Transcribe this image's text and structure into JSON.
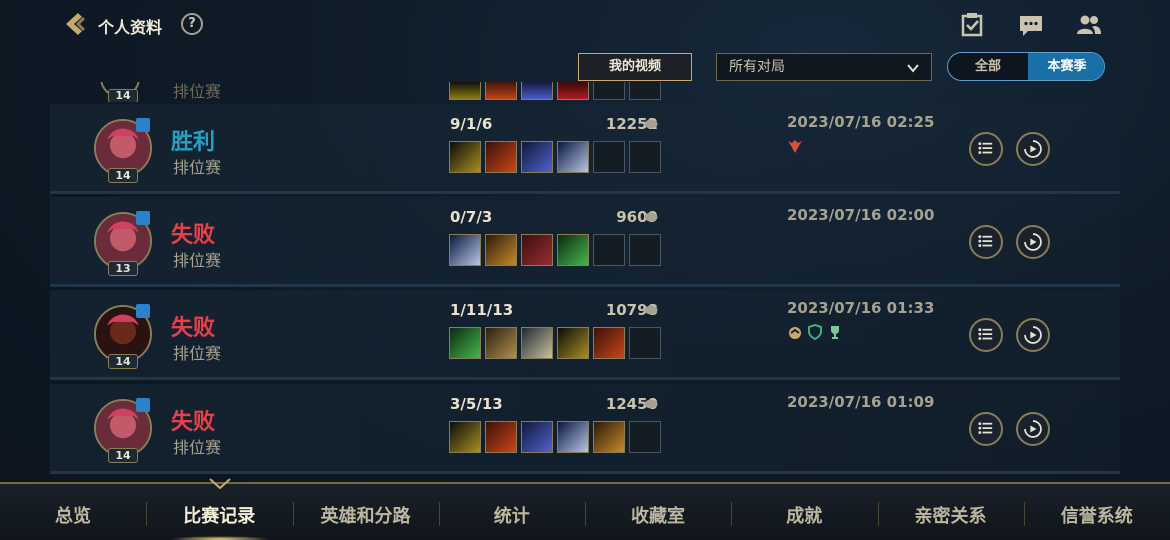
{
  "header": {
    "title": "个人资料",
    "help": "?",
    "icons": [
      "back-chevron-icon",
      "help-icon",
      "checklist-icon",
      "chat-icon",
      "friends-icon"
    ]
  },
  "filters": {
    "video_button": "我的视频",
    "match_filter": "所有对局",
    "season_toggle": {
      "all": "全部",
      "season": "本赛季",
      "selected": "本赛季"
    }
  },
  "partial_row": {
    "level": "14",
    "mode": "排位赛"
  },
  "matches": [
    {
      "result": "胜利",
      "outcome": "win",
      "mode": "排位赛",
      "level": "14",
      "kda": "9/1/6",
      "gold": "12252",
      "date": "2023/07/16 02:25",
      "items_filled": 4,
      "badges": [
        "mvp-wings-icon"
      ]
    },
    {
      "result": "失败",
      "outcome": "loss",
      "mode": "排位赛",
      "level": "13",
      "kda": "0/7/3",
      "gold": "9609",
      "date": "2023/07/16 02:00",
      "items_filled": 4,
      "badges": []
    },
    {
      "result": "失败",
      "outcome": "loss",
      "mode": "排位赛",
      "level": "14",
      "kda": "1/11/13",
      "gold": "10798",
      "date": "2023/07/16 01:33",
      "items_filled": 5,
      "badges": [
        "medal-icon",
        "shield-icon",
        "trophy-icon"
      ]
    },
    {
      "result": "失败",
      "outcome": "loss",
      "mode": "排位赛",
      "level": "14",
      "kda": "3/5/13",
      "gold": "12450",
      "date": "2023/07/16 01:09",
      "items_filled": 5,
      "badges": []
    }
  ],
  "tabs": [
    {
      "label": "总览"
    },
    {
      "label": "比赛记录",
      "active": true
    },
    {
      "label": "英雄和分路"
    },
    {
      "label": "统计"
    },
    {
      "label": "收藏室"
    },
    {
      "label": "成就"
    },
    {
      "label": "亲密关系"
    },
    {
      "label": "信誉系统"
    }
  ],
  "colors": {
    "win": "#1ea3c5",
    "loss": "#e8404a",
    "gold": "#c8aa6e",
    "toggle_active": "#1a6fa8"
  }
}
